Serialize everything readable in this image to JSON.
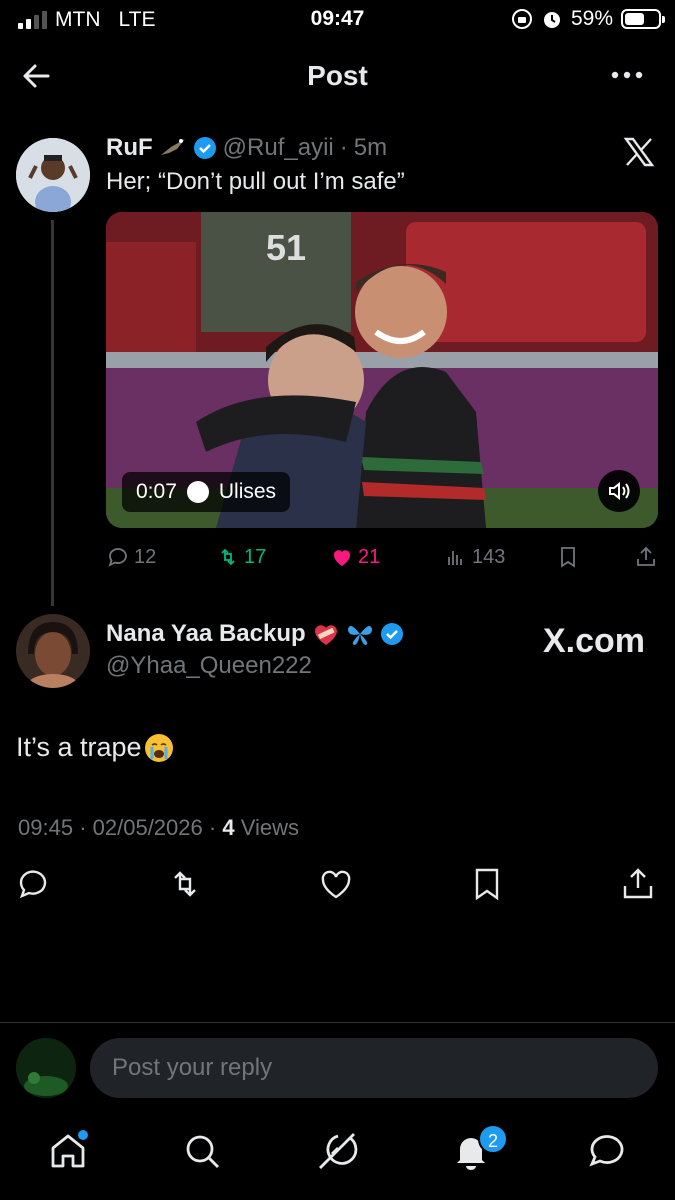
{
  "status_bar": {
    "carrier": "MTN",
    "network": "LTE",
    "time": "09:47",
    "battery_percent": "59%",
    "battery_level": 0.59
  },
  "header": {
    "title": "Post",
    "back_icon": "arrow-left-icon",
    "more_icon": "ellipsis-icon"
  },
  "parent_post": {
    "name": "RuF",
    "handle": "@Ruf_ayii",
    "separator": "·",
    "age": "5m",
    "text": "Her; “Don’t pull out I’m safe”",
    "video": {
      "duration": "0:07",
      "credit": "Ulises",
      "jersey_number": "51"
    },
    "stats": {
      "replies": "12",
      "reposts": "17",
      "likes": "21",
      "views": "143"
    },
    "colors": {
      "repost": "#00ba7c",
      "like": "#f91880",
      "verified": "#1d9bf0"
    }
  },
  "main_post": {
    "name": "Nana Yaa Backup",
    "handle": "@Yhaa_Queen222",
    "watermark": "X.com",
    "text": "It’s a trape",
    "time": "09:45",
    "date": "02/05/2026",
    "sep": "·",
    "views_count": "4",
    "views_label": "Views"
  },
  "reply": {
    "placeholder": "Post your reply"
  },
  "nav": {
    "items": [
      "home-icon",
      "search-icon",
      "grok-icon",
      "notifications-icon",
      "messages-icon"
    ],
    "notifications_count": "2"
  }
}
